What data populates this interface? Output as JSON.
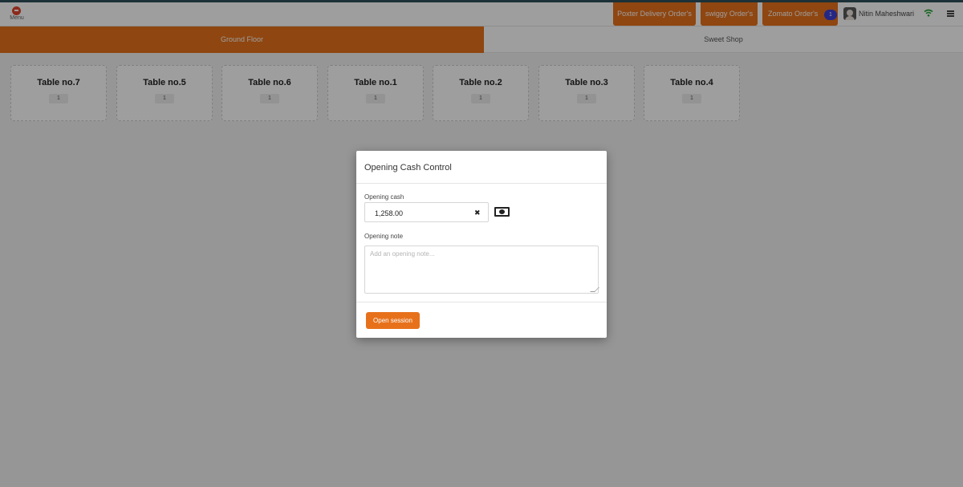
{
  "navbar": {
    "logo_text": "Menu",
    "buttons": [
      {
        "label": "Poxter Delivery Order's"
      },
      {
        "label": "swiggy Order's"
      },
      {
        "label": "Zomato Order's"
      }
    ],
    "notification_count": "1",
    "user_name": "Nitin Maheshwari",
    "icons": {
      "logo": "menu-logo-icon",
      "wifi": "wifi-icon",
      "menu": "hamburger-icon"
    },
    "accent_color": "#e7711b"
  },
  "floors": [
    {
      "label": "Ground Floor",
      "active": true
    },
    {
      "label": "Sweet Shop",
      "active": false
    }
  ],
  "tables": [
    {
      "name": "Table no.7",
      "count": "1"
    },
    {
      "name": "Table no.5",
      "count": "1"
    },
    {
      "name": "Table no.6",
      "count": "1"
    },
    {
      "name": "Table no.1",
      "count": "1"
    },
    {
      "name": "Table no.2",
      "count": "1"
    },
    {
      "name": "Table no.3",
      "count": "1"
    },
    {
      "name": "Table no.4",
      "count": "1"
    }
  ],
  "modal": {
    "title": "Opening Cash Control",
    "cash_label": "Opening cash",
    "cash_value": "1,258.00",
    "note_label": "Opening note",
    "note_placeholder": "Add an opening note...",
    "open_button": "Open session",
    "icons": {
      "clear": "clear-icon",
      "money": "money-icon"
    }
  }
}
